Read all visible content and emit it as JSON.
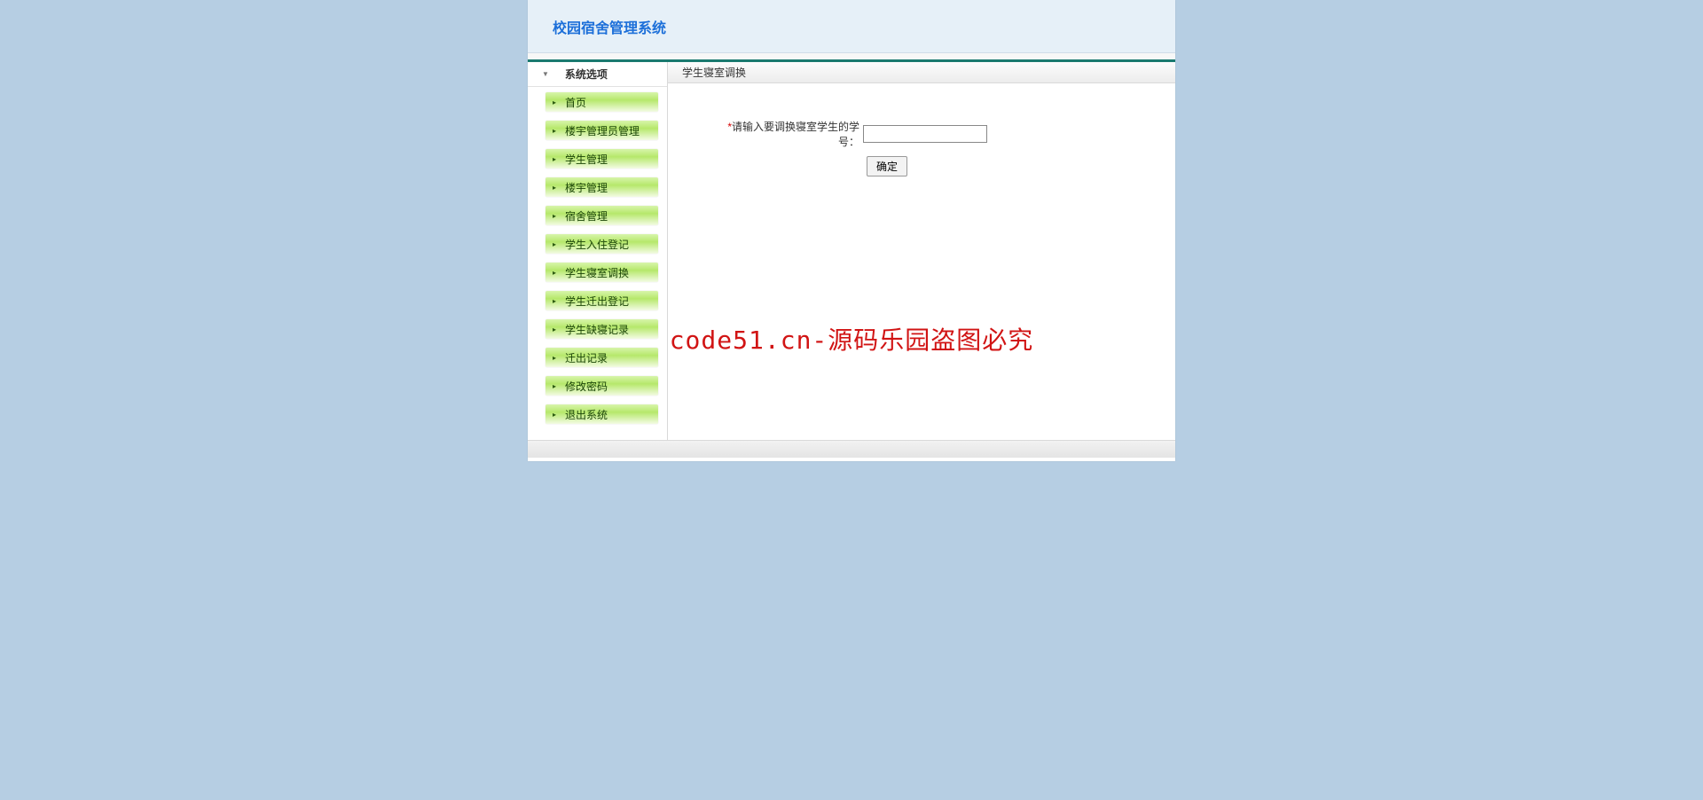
{
  "header": {
    "title": "校园宿舍管理系统"
  },
  "sidebar": {
    "title": "系统选项",
    "items": [
      {
        "label": "首页"
      },
      {
        "label": "楼宇管理员管理"
      },
      {
        "label": "学生管理"
      },
      {
        "label": "楼宇管理"
      },
      {
        "label": "宿舍管理"
      },
      {
        "label": "学生入住登记"
      },
      {
        "label": "学生寝室调换"
      },
      {
        "label": "学生迁出登记"
      },
      {
        "label": "学生缺寝记录"
      },
      {
        "label": "迁出记录"
      },
      {
        "label": "修改密码"
      },
      {
        "label": "退出系统"
      }
    ]
  },
  "content": {
    "title": "学生寝室调换",
    "form_label": "请输入要调换寝室学生的学号：",
    "required_mark": "*",
    "submit_label": "确定"
  },
  "watermark": "code51.cn-源码乐园盗图必究"
}
